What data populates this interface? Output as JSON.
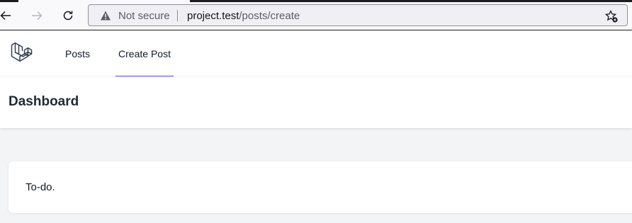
{
  "browser": {
    "security_label": "Not secure",
    "url_host": "project.test",
    "url_path": "/posts/create"
  },
  "nav": {
    "links": [
      {
        "label": "Posts",
        "active": false
      },
      {
        "label": "Create Post",
        "active": true
      }
    ],
    "accent_color": "#4f46e5"
  },
  "header": {
    "title": "Dashboard"
  },
  "card": {
    "text": "To-do."
  }
}
